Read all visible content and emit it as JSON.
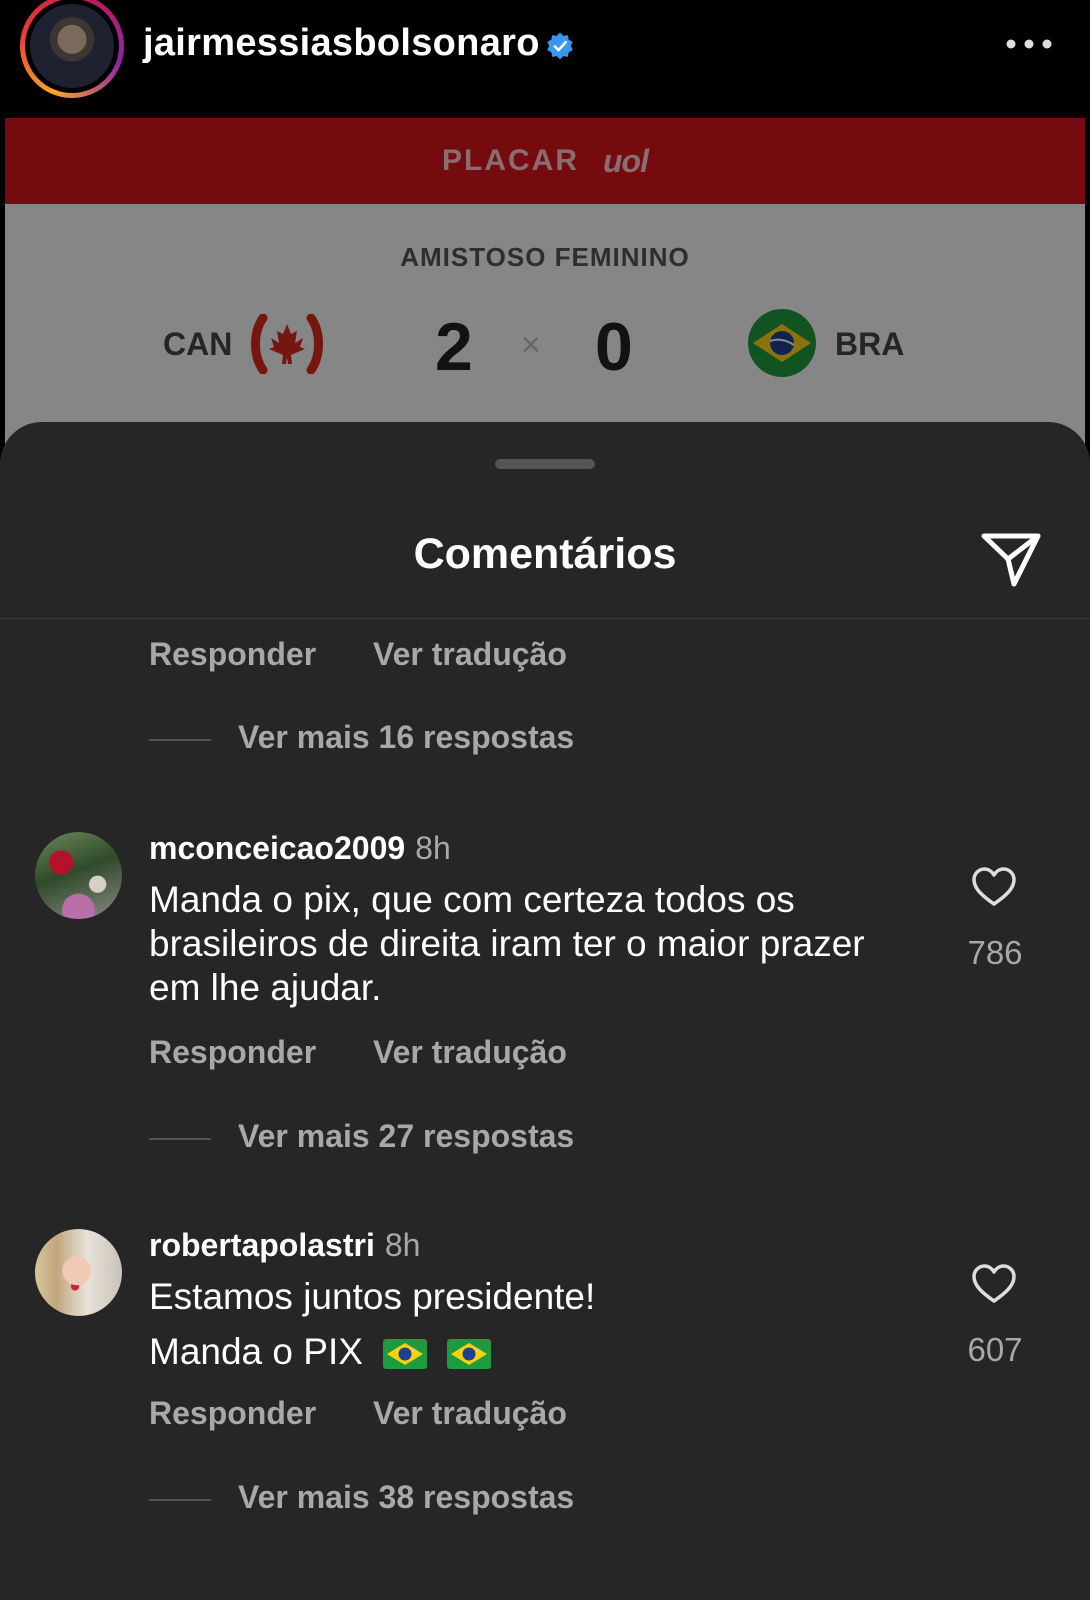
{
  "post": {
    "username": "jairmessiasbolsonaro",
    "verified": true,
    "avatar_icon": "profile-photo",
    "more_icon": "more-horizontal-icon"
  },
  "scoreboard": {
    "banner_text": "PLACAR",
    "banner_logo": "uol",
    "competition": "AMISTOSO FEMININO",
    "home_team": "CAN",
    "home_score": "2",
    "separator": "×",
    "away_score": "0",
    "away_team": "BRA",
    "colors": {
      "banner": "#d6131c"
    }
  },
  "sheet": {
    "title": "Comentários",
    "share_icon": "paper-plane-icon"
  },
  "top_actions": {
    "reply": "Responder",
    "translate": "Ver tradução"
  },
  "top_more_replies": "Ver mais 16 respostas",
  "comments": [
    {
      "username": "mconceicao2009",
      "time": "8h",
      "text": "Manda o pix, que com certeza todos os brasileiros de direita iram ter o maior prazer em lhe ajudar.",
      "likes": "786",
      "reply_label": "Responder",
      "translate_label": "Ver tradução",
      "more_replies": "Ver mais 27 respostas"
    },
    {
      "username": "robertapolastri",
      "time": "8h",
      "text_line1": "Estamos juntos presidente!",
      "text_line2": "Manda o PIX",
      "likes": "607",
      "reply_label": "Responder",
      "translate_label": "Ver tradução",
      "more_replies": "Ver mais 38 respostas"
    }
  ],
  "theme": {
    "background": "#000000",
    "sheet_background": "#262626",
    "secondary_text": "#a8a8a8",
    "verified_blue": "#3897f0"
  }
}
